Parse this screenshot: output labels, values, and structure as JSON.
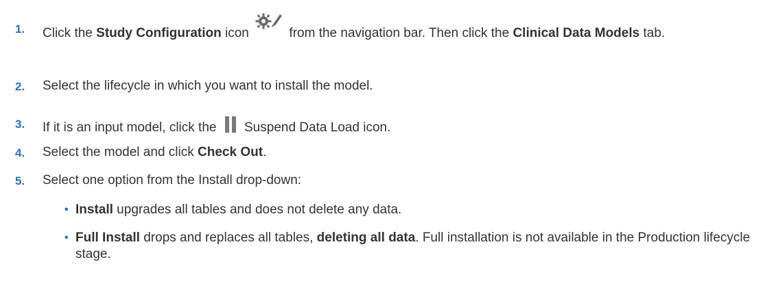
{
  "steps": [
    {
      "number": "1.",
      "parts": {
        "a": "Click the ",
        "b": "Study Configuration",
        "c": " icon",
        "d": " from the navigation bar. Then click the ",
        "e": "Clinical Data Models",
        "f": " tab."
      },
      "icon": "study-configuration-gear-pencil-icon"
    },
    {
      "number": "2.",
      "text": "Select the lifecycle in which you want to install the model."
    },
    {
      "number": "3.",
      "parts": {
        "a": "If it is an input model, click the ",
        "b": " Suspend Data Load icon."
      },
      "icon": "pause-icon"
    },
    {
      "number": "4.",
      "parts": {
        "a": "Select the model and click ",
        "b": "Check Out",
        "c": "."
      }
    },
    {
      "number": "5.",
      "text": "Select one option from the Install drop-down:"
    }
  ],
  "bullets": [
    {
      "symbol": "•",
      "parts": {
        "a": "Install",
        "b": " upgrades all tables and does not delete any data."
      }
    },
    {
      "symbol": "•",
      "parts": {
        "a": "Full Install",
        "b": " drops and replaces all tables, ",
        "c": "deleting all data",
        "d": ". Full installation is not available in the Production lifecycle stage."
      }
    }
  ],
  "colors": {
    "number": "#2e6fb0",
    "text": "#333333",
    "icon": "#6b6b6b"
  }
}
